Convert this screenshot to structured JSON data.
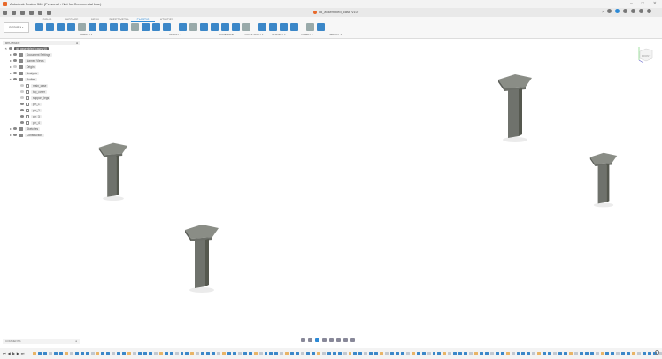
{
  "app": {
    "title": "Autodesk Fusion 360 (Personal - Not for Commercial Use)",
    "document_tab": "lid_assembled_case v10*"
  },
  "ribbon": {
    "workspace": "DESIGN ▾",
    "tabs": [
      {
        "label": "SOLID"
      },
      {
        "label": "SURFACE"
      },
      {
        "label": "MESH"
      },
      {
        "label": "SHEET METAL"
      },
      {
        "label": "PLASTIC",
        "active": true
      },
      {
        "label": "UTILITIES"
      }
    ],
    "groups": [
      {
        "label": "CREATE ▾"
      },
      {
        "label": "MODIFY ▾"
      },
      {
        "label": "ASSEMBLE ▾"
      },
      {
        "label": "CONSTRUCT ▾"
      },
      {
        "label": "INSPECT ▾"
      },
      {
        "label": "INSERT ▾"
      },
      {
        "label": "SELECT ▾"
      }
    ]
  },
  "browser": {
    "title": "BROWSER",
    "root": "lid_assembled_case v10",
    "items": [
      {
        "label": "Document Settings",
        "type": "gear"
      },
      {
        "label": "Named Views",
        "type": "folder"
      },
      {
        "label": "Origin",
        "type": "folder",
        "hidden": true
      },
      {
        "label": "Analysis",
        "type": "folder"
      },
      {
        "label": "Bodies",
        "type": "folder",
        "expanded": true
      }
    ],
    "bodies": [
      {
        "label": "main_case",
        "visible": false
      },
      {
        "label": "top_cover",
        "visible": false
      },
      {
        "label": "support_legs",
        "visible": false
      },
      {
        "label": "pin_1",
        "visible": true
      },
      {
        "label": "pin_2",
        "visible": true
      },
      {
        "label": "pin_3",
        "visible": true
      },
      {
        "label": "pin_4",
        "visible": true
      }
    ],
    "after": [
      {
        "label": "Sketches"
      },
      {
        "label": "Construction"
      }
    ]
  },
  "comments": {
    "title": "COMMENTS"
  },
  "viewcube": {
    "face": "FRONT"
  },
  "colors": {
    "accent": "#2d8ad6",
    "brand": "#e8692b",
    "pin": "#6f726c"
  },
  "timeline": {
    "feature_count": 120
  }
}
